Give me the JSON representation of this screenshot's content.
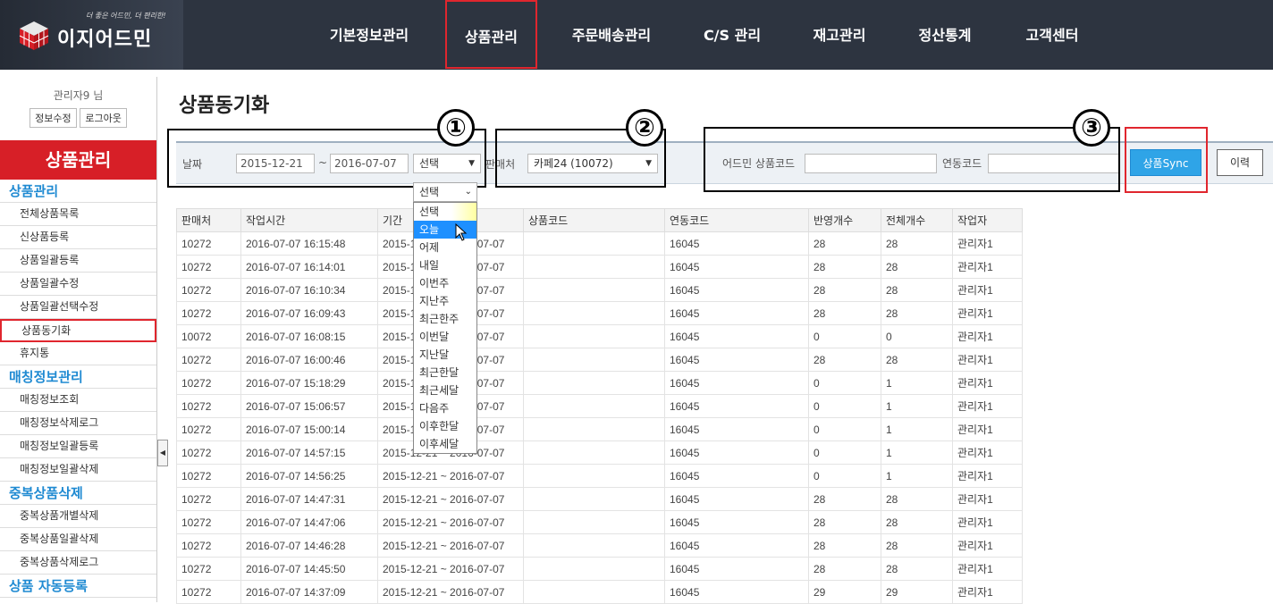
{
  "header": {
    "logo_text": "이지어드민",
    "slogan": "더 좋은 어드민, 더 편리한!",
    "nav": [
      "기본정보관리",
      "상품관리",
      "주문배송관리",
      "C/S 관리",
      "재고관리",
      "정산통계",
      "고객센터"
    ]
  },
  "sidebar": {
    "user": "관리자9 님",
    "edit_label": "정보수정",
    "logout_label": "로그아웃",
    "title": "상품관리",
    "groups": [
      {
        "label": "상품관리",
        "items": [
          "전체상품목록",
          "신상품등록",
          "상품일괄등록",
          "상품일괄수정",
          "상품일괄선택수정",
          "상품동기화",
          "휴지통"
        ]
      },
      {
        "label": "매칭정보관리",
        "items": [
          "매칭정보조회",
          "매칭정보삭제로그",
          "매칭정보일괄등록",
          "매칭정보일괄삭제"
        ]
      },
      {
        "label": "중복상품삭제",
        "items": [
          "중복상품개별삭제",
          "중복상품일괄삭제",
          "중복상품삭제로그"
        ]
      },
      {
        "label": "상품 자동등록",
        "items": []
      }
    ],
    "active_item": "상품동기화"
  },
  "page": {
    "title": "상품동기화"
  },
  "filters": {
    "date_label": "날짜",
    "date_from": "2015-12-21",
    "tilde": "~",
    "date_to": "2016-07-07",
    "period_select": "선택",
    "seller_label": "판매처",
    "seller_select": "카페24 (10072)",
    "admin_code_label": "어드민 상품코드",
    "link_code_label": "연동코드",
    "sync_button": "상품Sync",
    "history_button": "이력"
  },
  "annotations": {
    "one": "①",
    "two": "②",
    "three": "③"
  },
  "dropdown": {
    "header": "선택",
    "options": [
      "선택",
      "오늘",
      "어제",
      "내일",
      "이번주",
      "지난주",
      "최근한주",
      "이번달",
      "지난달",
      "최근한달",
      "최근세달",
      "다음주",
      "이후한달",
      "이후세달"
    ],
    "highlighted": "오늘"
  },
  "table": {
    "columns": [
      "판매처",
      "작업시간",
      "기간",
      "상품코드",
      "연동코드",
      "반영개수",
      "전체개수",
      "작업자"
    ],
    "rows": [
      [
        "10272",
        "2016-07-07 16:15:48",
        "2015-12-21 ~ 2016-07-07",
        "",
        "16045",
        "28",
        "28",
        "관리자1"
      ],
      [
        "10272",
        "2016-07-07 16:14:01",
        "2015-12-21 ~ 2016-07-07",
        "",
        "16045",
        "28",
        "28",
        "관리자1"
      ],
      [
        "10272",
        "2016-07-07 16:10:34",
        "2015-12-21 ~ 2016-07-07",
        "",
        "16045",
        "28",
        "28",
        "관리자1"
      ],
      [
        "10272",
        "2016-07-07 16:09:43",
        "2015-12-21 ~ 2016-07-07",
        "",
        "16045",
        "28",
        "28",
        "관리자1"
      ],
      [
        "10072",
        "2016-07-07 16:08:15",
        "2015-12-21 ~ 2016-07-07",
        "",
        "16045",
        "0",
        "0",
        "관리자1"
      ],
      [
        "10272",
        "2016-07-07 16:00:46",
        "2015-12-21 ~ 2016-07-07",
        "",
        "16045",
        "28",
        "28",
        "관리자1"
      ],
      [
        "10272",
        "2016-07-07 15:18:29",
        "2015-12-21 ~ 2016-07-07",
        "",
        "16045",
        "0",
        "1",
        "관리자1"
      ],
      [
        "10272",
        "2016-07-07 15:06:57",
        "2015-12-21 ~ 2016-07-07",
        "",
        "16045",
        "0",
        "1",
        "관리자1"
      ],
      [
        "10272",
        "2016-07-07 15:00:14",
        "2015-12-21 ~ 2016-07-07",
        "",
        "16045",
        "0",
        "1",
        "관리자1"
      ],
      [
        "10272",
        "2016-07-07 14:57:15",
        "2015-12-21 ~ 2016-07-07",
        "",
        "16045",
        "0",
        "1",
        "관리자1"
      ],
      [
        "10272",
        "2016-07-07 14:56:25",
        "2015-12-21 ~ 2016-07-07",
        "",
        "16045",
        "0",
        "1",
        "관리자1"
      ],
      [
        "10272",
        "2016-07-07 14:47:31",
        "2015-12-21 ~ 2016-07-07",
        "",
        "16045",
        "28",
        "28",
        "관리자1"
      ],
      [
        "10272",
        "2016-07-07 14:47:06",
        "2015-12-21 ~ 2016-07-07",
        "",
        "16045",
        "28",
        "28",
        "관리자1"
      ],
      [
        "10272",
        "2016-07-07 14:46:28",
        "2015-12-21 ~ 2016-07-07",
        "",
        "16045",
        "28",
        "28",
        "관리자1"
      ],
      [
        "10272",
        "2016-07-07 14:45:50",
        "2015-12-21 ~ 2016-07-07",
        "",
        "16045",
        "28",
        "28",
        "관리자1"
      ],
      [
        "10272",
        "2016-07-07 14:37:09",
        "2015-12-21 ~ 2016-07-07",
        "",
        "16045",
        "29",
        "29",
        "관리자1"
      ]
    ]
  },
  "colors": {
    "header_bg": "#2d3440",
    "brand_red": "#d71f27",
    "accent_blue": "#2fa4e7",
    "highlight_border": "#e0262e"
  }
}
